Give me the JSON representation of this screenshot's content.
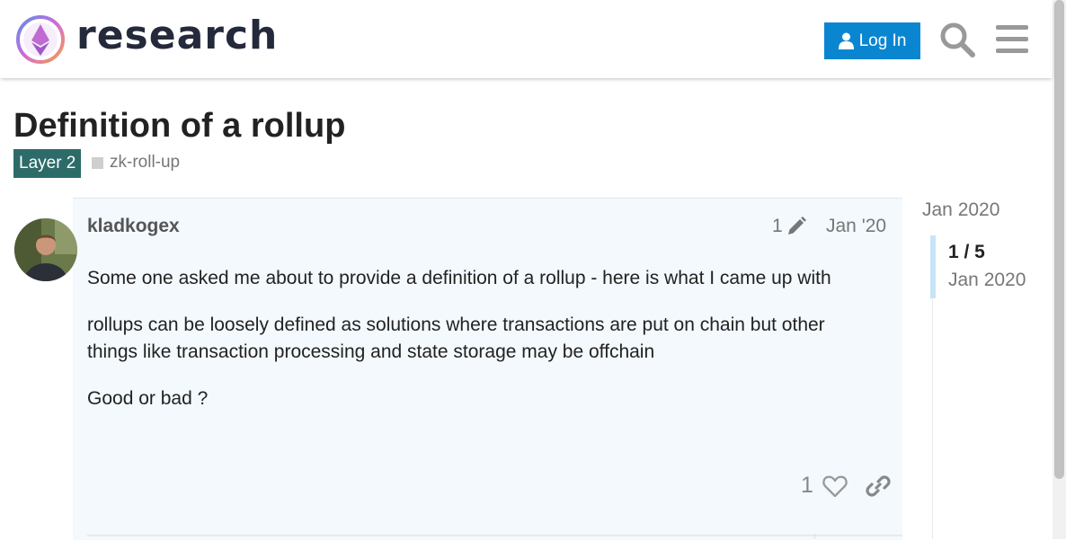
{
  "header": {
    "logo_text": "research",
    "login_label": "Log In",
    "icons": [
      "logo-icon",
      "user-icon",
      "search-icon",
      "menu-icon"
    ]
  },
  "topic": {
    "title": "Definition of a rollup",
    "category": "Layer 2",
    "tag": "zk-roll-up"
  },
  "post": {
    "username": "kladkogex",
    "edit_count": "1",
    "date": "Jan '20",
    "paragraphs": [
      "Some one asked me about to provide a definition of a rollup - here is what I came up with",
      "rollups can be loosely defined as solutions where transactions are put on chain but other things like transaction processing and state storage may be offchain",
      "Good or bad ?"
    ],
    "like_count": "1",
    "icons": [
      "pencil-icon",
      "heart-icon",
      "link-icon"
    ]
  },
  "timeline": {
    "start": "Jan 2020",
    "progress": "1 / 5",
    "current_date": "Jan 2020"
  },
  "colors": {
    "brand_blue": "#0a86d0",
    "category": "#2d6b69",
    "post_bg": "#f3f9fd",
    "timeline_handle": "#c7e4f7"
  }
}
